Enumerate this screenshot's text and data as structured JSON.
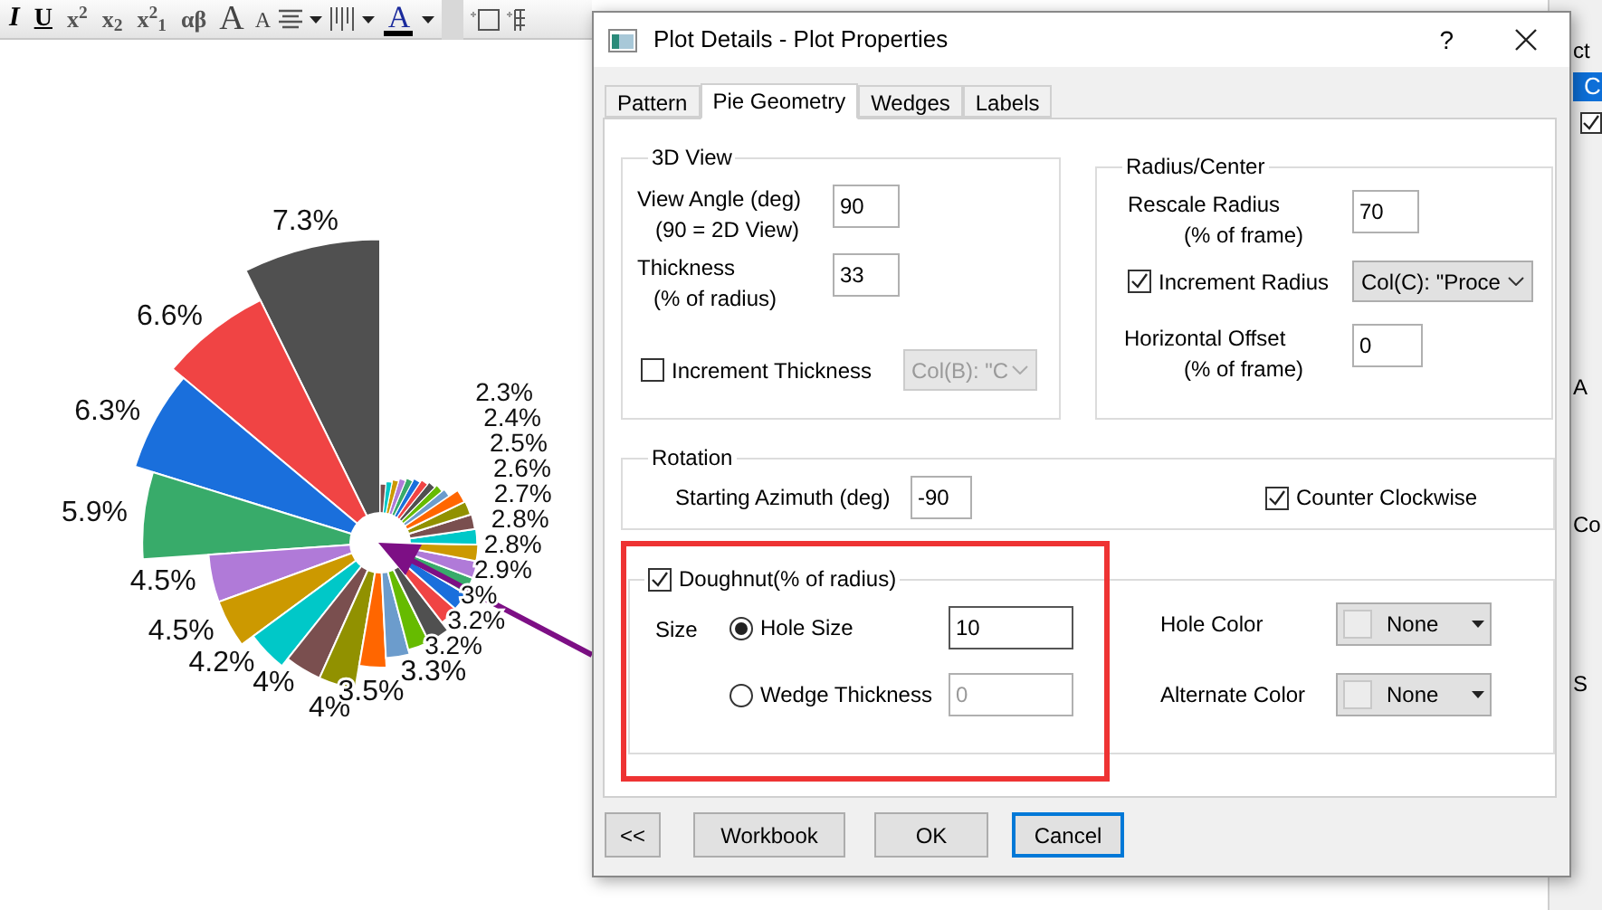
{
  "toolbar": {
    "items": [
      {
        "kind": "italic",
        "label": "I"
      },
      {
        "kind": "underline",
        "label": "U"
      },
      {
        "kind": "superscript",
        "label": "x$^{2}$"
      },
      {
        "kind": "subscript",
        "label": "x$_{2}$"
      },
      {
        "kind": "supsub",
        "label": "x$^{2}$$_{1}$"
      },
      {
        "kind": "greek",
        "label": "αβ"
      },
      {
        "kind": "grow",
        "label": "A"
      },
      {
        "kind": "shrink",
        "label": "A"
      },
      {
        "kind": "align"
      },
      {
        "kind": "dropdown"
      },
      {
        "kind": "bars"
      },
      {
        "kind": "dropdown"
      },
      {
        "kind": "fontcolor",
        "label": "A"
      },
      {
        "kind": "dropdown"
      },
      {
        "kind": "scroll"
      },
      {
        "kind": "frame"
      },
      {
        "kind": "table"
      }
    ]
  },
  "pie_graph": {
    "wedge_labels": [
      "2.3%",
      "2.4%",
      "2.5%",
      "2.6%",
      "2.7%",
      "2.8%",
      "2.8%",
      "2.9%",
      "3%",
      "3.2%",
      "3.2%",
      "3.3%",
      "3.5%",
      "4%",
      "4%",
      "4.2%",
      "4.5%",
      "4.5%",
      "5.9%",
      "6.3%",
      "6.6%",
      "7.3%"
    ]
  },
  "side_panel": {
    "items": [
      {
        "kind": "text",
        "label": "ct"
      },
      {
        "kind": "row",
        "label": "C",
        "selected": true
      },
      {
        "kind": "check",
        "checked": true
      },
      {
        "kind": "text",
        "label": "A"
      },
      {
        "kind": "text",
        "label": "Co"
      },
      {
        "kind": "text",
        "label": "S"
      }
    ]
  },
  "dialog": {
    "title": "Plot Details - Plot Properties",
    "help": "?",
    "tabs": [
      {
        "label": "Pattern",
        "selected": false
      },
      {
        "label": "Pie Geometry",
        "selected": true
      },
      {
        "label": "Wedges",
        "selected": false
      },
      {
        "label": "Labels",
        "selected": false
      }
    ],
    "view3d": {
      "legend": "3D View",
      "view_angle": {
        "label": "View Angle (deg)",
        "sublabel": "(90 = 2D View)",
        "value": "90"
      },
      "thickness": {
        "label": "Thickness",
        "sublabel": "(% of radius)",
        "value": "33"
      },
      "increment_thickness": {
        "label": "Increment Thickness",
        "checked": false,
        "dropdown": "Col(B): \"C"
      }
    },
    "radius_center": {
      "legend": "Radius/Center",
      "rescale": {
        "label": "Rescale Radius",
        "sublabel": "(% of frame)",
        "value": "70"
      },
      "increment_radius": {
        "label": "Increment Radius",
        "checked": true,
        "dropdown": "Col(C): \"Proce"
      },
      "offset": {
        "label": "Horizontal Offset",
        "sublabel": "(% of frame)",
        "value": "0"
      }
    },
    "rotation": {
      "legend": "Rotation",
      "azimuth": {
        "label": "Starting Azimuth (deg)",
        "value": "-90"
      },
      "counter_clockwise": {
        "label": "Counter Clockwise",
        "checked": true
      }
    },
    "doughnut": {
      "label": "Doughnut(% of radius)",
      "checked": true,
      "size_label": "Size",
      "options": [
        {
          "label": "Hole Size",
          "selected": true,
          "value": "10"
        },
        {
          "label": "Wedge Thickness",
          "selected": false,
          "value": "0"
        }
      ],
      "colors": [
        {
          "label": "Hole Color",
          "value": "None"
        },
        {
          "label": "Alternate Color",
          "value": "None"
        }
      ]
    },
    "buttons": [
      {
        "label": "<<",
        "focused": false
      },
      {
        "label": "Workbook",
        "focused": false
      },
      {
        "label": "OK",
        "focused": false
      },
      {
        "label": "Cancel",
        "focused": true
      }
    ]
  }
}
